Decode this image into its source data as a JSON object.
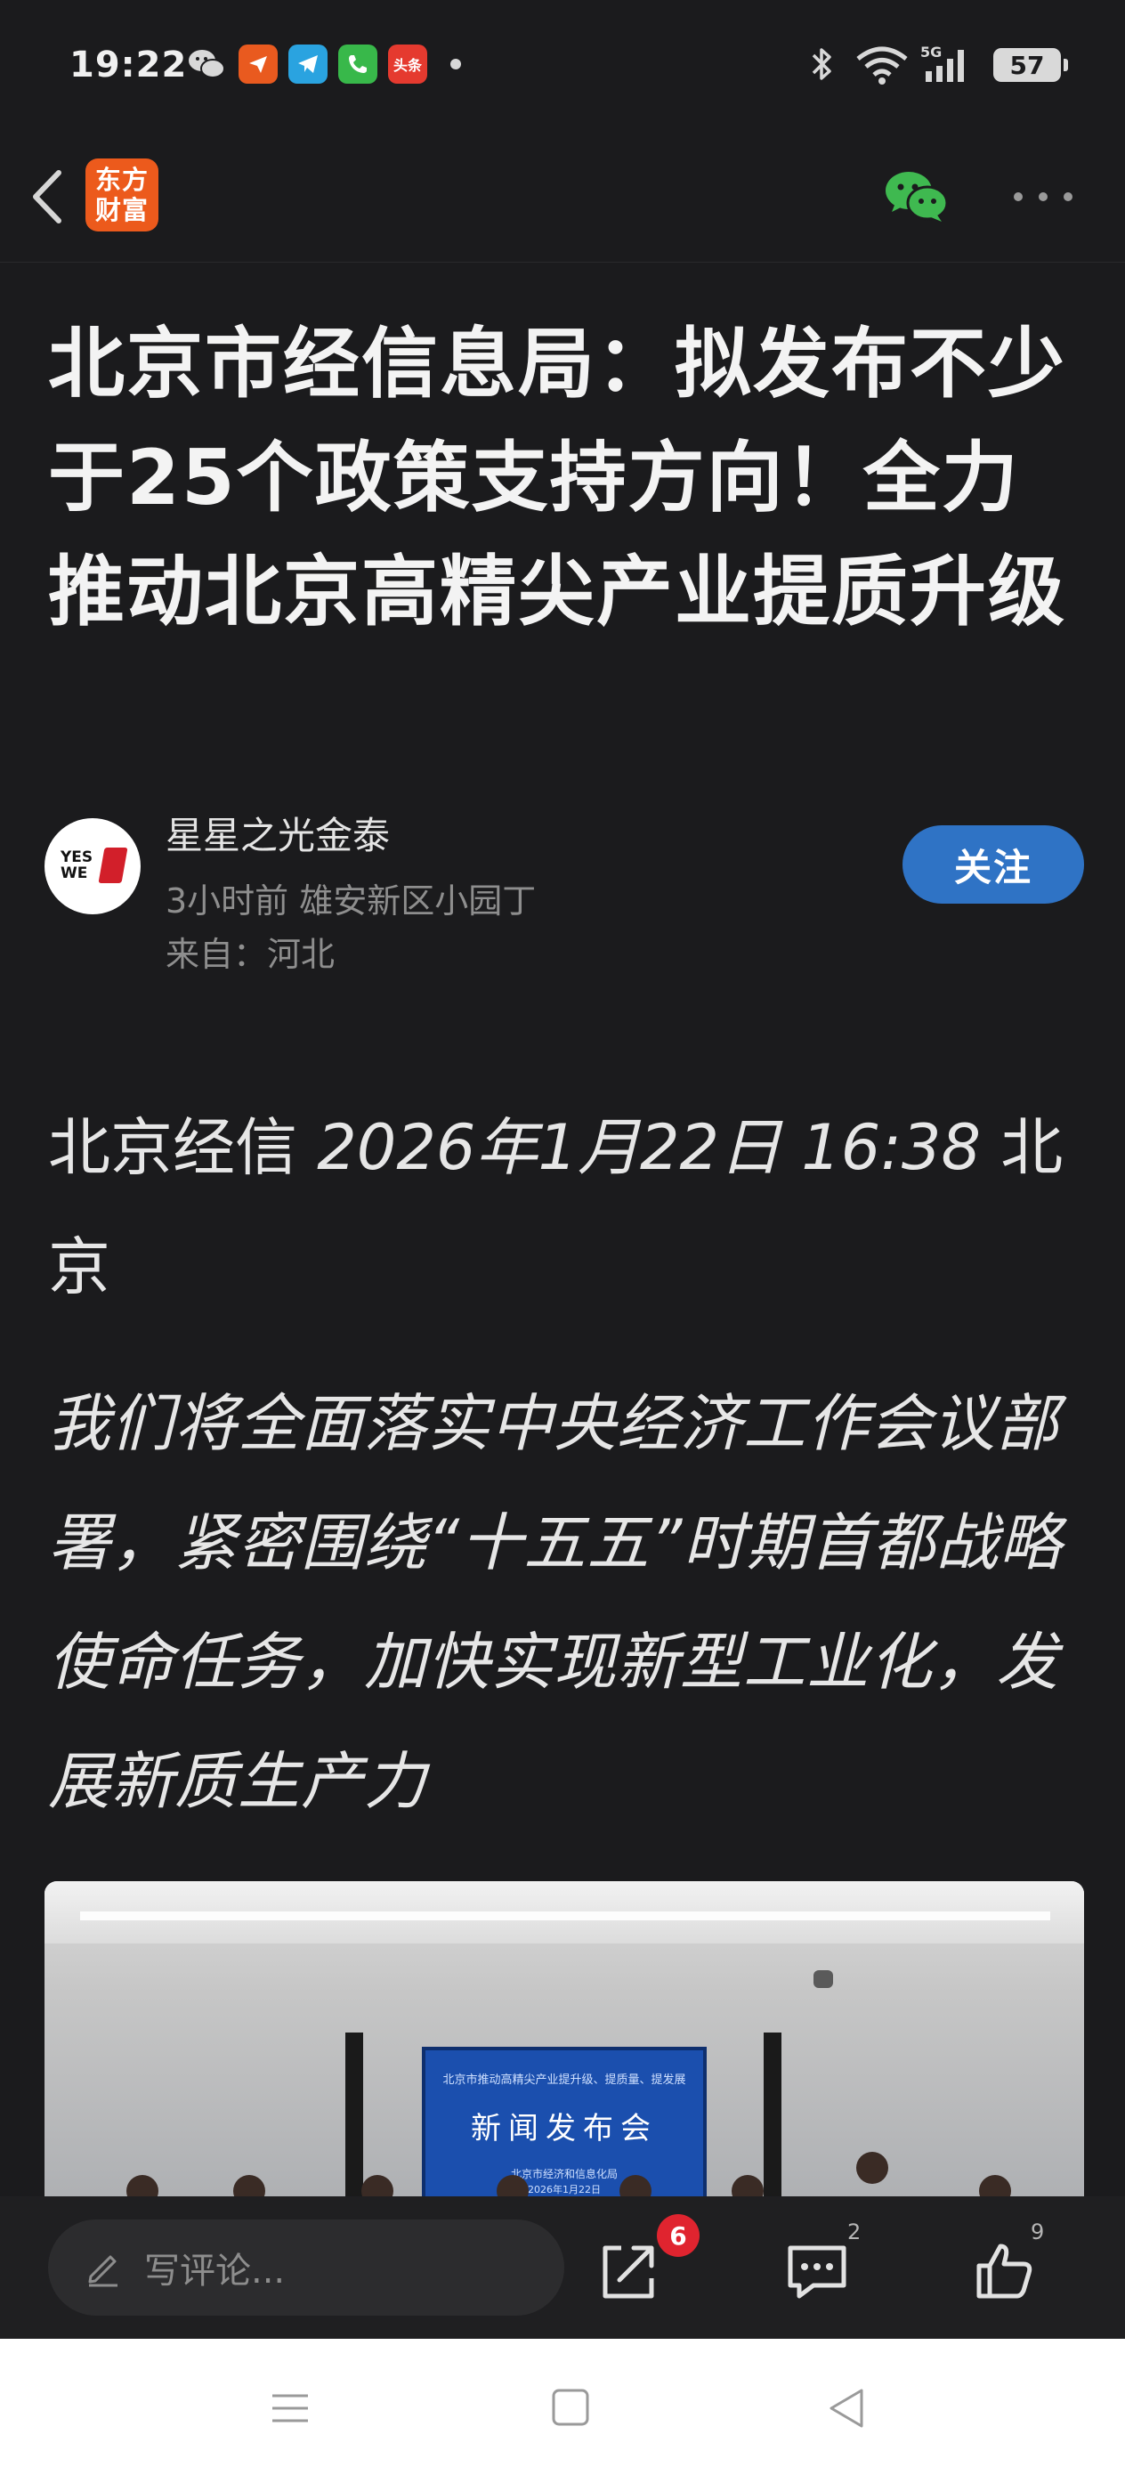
{
  "status_bar": {
    "time": "19:22",
    "notification_icons": [
      "wechat-icon",
      "app-orange-icon",
      "telegram-icon",
      "phone-icon",
      "toutiao-icon"
    ],
    "toutiao_label": "头条",
    "network": "5G",
    "battery": "57"
  },
  "app_bar": {
    "logo_line1": "东方",
    "logo_line2": "财富",
    "logo_color": "#ec5a1c"
  },
  "article": {
    "title": "北京市经信息局：拟发布不少于25个政策支持方向！全力推动北京高精尖产业提质升级",
    "author": {
      "name": "星星之光金泰",
      "avatar_text": "YES WE",
      "meta": "3小时前 雄安新区小园丁",
      "source": "来自：河北"
    },
    "follow_label": "关注",
    "dateline_source": "北京经信 ",
    "dateline_time": "2026年1月22日 16:38 ",
    "dateline_place": "北京",
    "lead": "我们将全面落实中央经济工作会议部署，紧密围绕“十五五”时期首都战略使命任务，加快实现新型工业化，发展新质生产力",
    "photo": {
      "screen_top": "北京市推动高精尖产业提升级、提质量、提发展",
      "screen_title": "新闻发布会",
      "screen_org": "北京市经济和信息化局",
      "screen_date": "2026年1月22日"
    }
  },
  "action_bar": {
    "comment_placeholder": "写评论...",
    "share_badge": "6",
    "comments_count": "2",
    "likes_count": "9"
  },
  "colors": {
    "background": "#1b1b1d",
    "follow_button": "#2f73c5",
    "badge": "#e0242f"
  }
}
